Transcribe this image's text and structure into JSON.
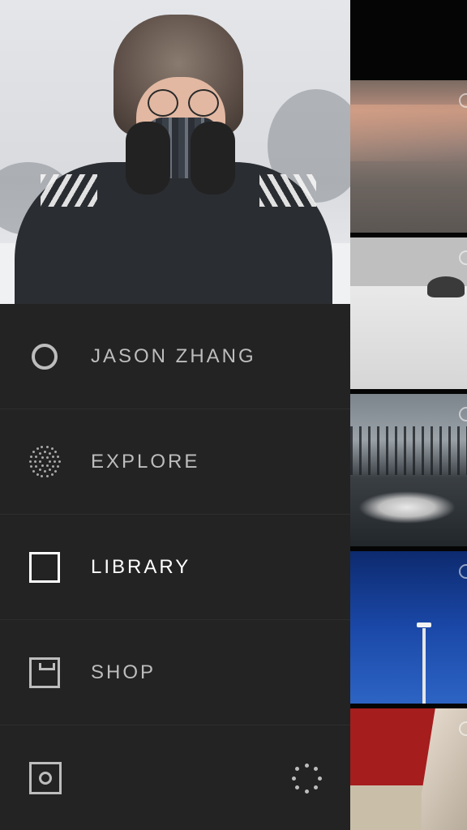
{
  "profile": {
    "photo_description_icon": "profile-photo"
  },
  "menu": {
    "items": [
      {
        "label": "JASON ZHANG",
        "icon": "profile-circle-icon",
        "active": false
      },
      {
        "label": "EXPLORE",
        "icon": "explore-dots-icon",
        "active": false
      },
      {
        "label": "LIBRARY",
        "icon": "library-square-icon",
        "active": true
      },
      {
        "label": "SHOP",
        "icon": "shop-box-icon",
        "active": false
      }
    ]
  },
  "bottom": {
    "left_icon": "camera-icon",
    "right_icon": "settings-dots-icon"
  },
  "colors": {
    "drawer_bg": "#232323",
    "label_inactive": "#bdbdbd",
    "label_active": "#ffffff"
  }
}
